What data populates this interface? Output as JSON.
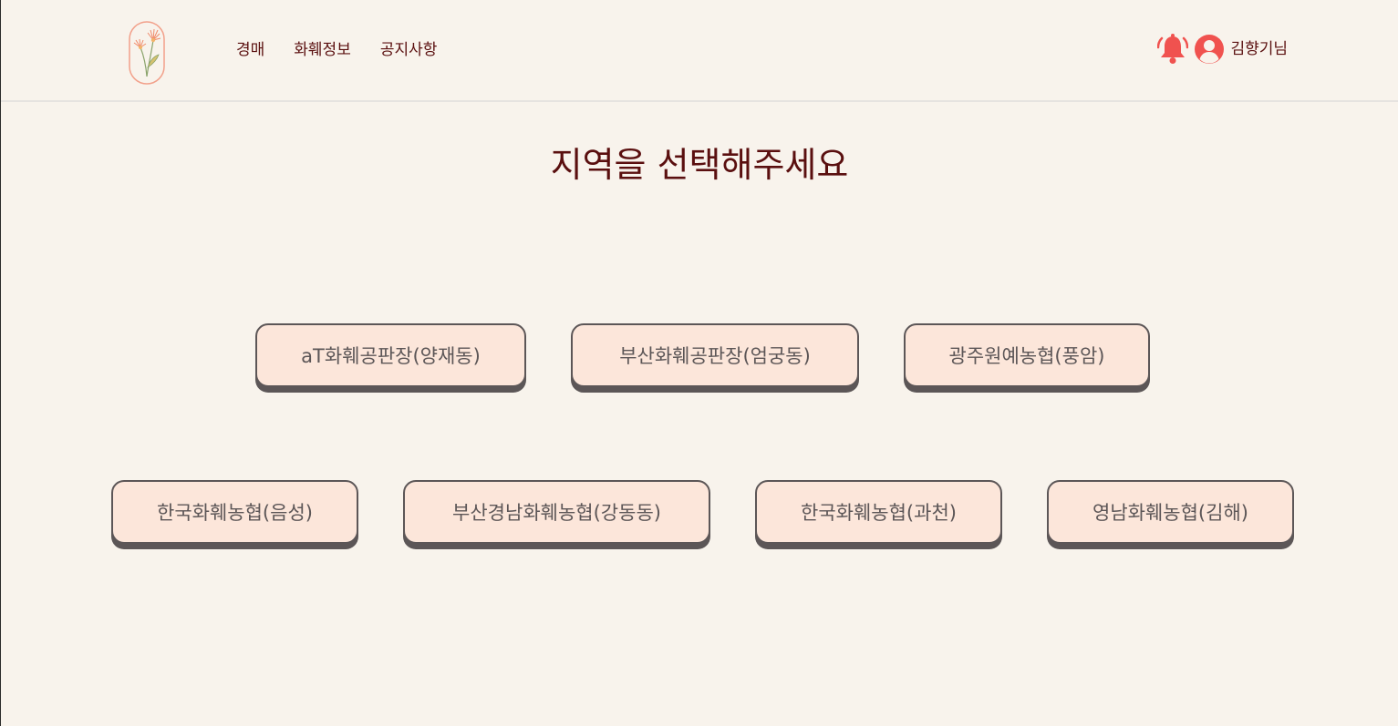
{
  "header": {
    "logo_icon": "flower-logo-icon",
    "nav": [
      {
        "label": "경매"
      },
      {
        "label": "화훼정보"
      },
      {
        "label": "공지사항"
      }
    ],
    "notification_icon": "bell-icon",
    "avatar_icon": "user-avatar-icon",
    "user_name": "김향기님",
    "accent_color": "#f0524f"
  },
  "main": {
    "title": "지역을 선택해주세요",
    "regions_row1": [
      {
        "label": "aT화훼공판장(양재동)"
      },
      {
        "label": "부산화훼공판장(엄궁동)"
      },
      {
        "label": "광주원예농협(풍암)"
      }
    ],
    "regions_row2": [
      {
        "label": "한국화훼농협(음성)"
      },
      {
        "label": "부산경남화훼농협(강동동)"
      },
      {
        "label": "한국화훼농협(과천)"
      },
      {
        "label": "영남화훼농협(김해)"
      }
    ]
  },
  "colors": {
    "background": "#f8f3ec",
    "button_fill": "#fce6da",
    "button_border": "#5c5657",
    "title_text": "#5a0f0f"
  }
}
